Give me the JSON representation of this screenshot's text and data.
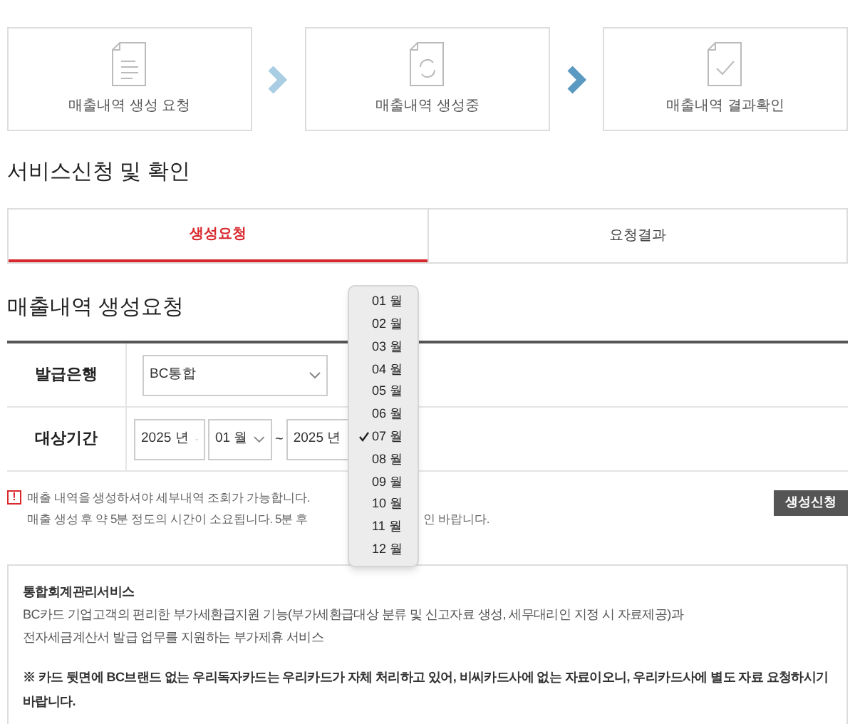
{
  "steps": [
    {
      "kind": "list",
      "label": "매출내역 생성 요청"
    },
    {
      "kind": "refresh",
      "label": "매출내역 생성중"
    },
    {
      "kind": "check",
      "label": "매출내역 결과확인"
    }
  ],
  "section_title": "서비스신청 및 확인",
  "tabs": [
    {
      "label": "생성요청",
      "selected": true
    },
    {
      "label": "요청결과",
      "selected": false
    }
  ],
  "form_title": "매출내역 생성요청",
  "form": {
    "bank_label": "발급은행",
    "bank_value": "BC통합",
    "period_label": "대상기간",
    "start_year": "2025 년",
    "start_month": "01 월",
    "separator": "~",
    "end_year": "2025 년"
  },
  "notice": {
    "icon": "!",
    "lines": [
      "매출 내역을 생성하셔야 세부내역 조회가 가능합니다."
    ],
    "second_line_parts": [
      "매출 생성 후 약 5분 정도의 시간이 소요됩니다. 5분 후",
      "인 바랍니다."
    ]
  },
  "submit_button": "생성신청",
  "info": {
    "title": "통합회계관리서비스",
    "lines": [
      "BC카드 기업고객의 편리한 부가세환급지원 기능(부가세환급대상 분류 및 신고자료 생성, 세무대리인 지정 시 자료제공)과",
      "전자세금계산서 발급 업무를 지원하는 부가제휴 서비스"
    ],
    "warning": "※ 카드 뒷면에 BC브랜드 없는 우리독자카드는 우리카드가 자체 처리하고 있어, 비씨카드사에 없는 자료이오니, 우리카드사에 별도 자료 요청하시기 바랍니다."
  },
  "month_menu": [
    {
      "label": "01 월",
      "selected": false
    },
    {
      "label": "02 월",
      "selected": false
    },
    {
      "label": "03 월",
      "selected": false
    },
    {
      "label": "04 월",
      "selected": false
    },
    {
      "label": "05 월",
      "selected": false
    },
    {
      "label": "06 월",
      "selected": false
    },
    {
      "label": "07 월",
      "selected": true
    },
    {
      "label": "08 월",
      "selected": false
    },
    {
      "label": "09 월",
      "selected": false
    },
    {
      "label": "10 월",
      "selected": false
    },
    {
      "label": "11 월",
      "selected": false
    },
    {
      "label": "12 월",
      "selected": false
    }
  ]
}
